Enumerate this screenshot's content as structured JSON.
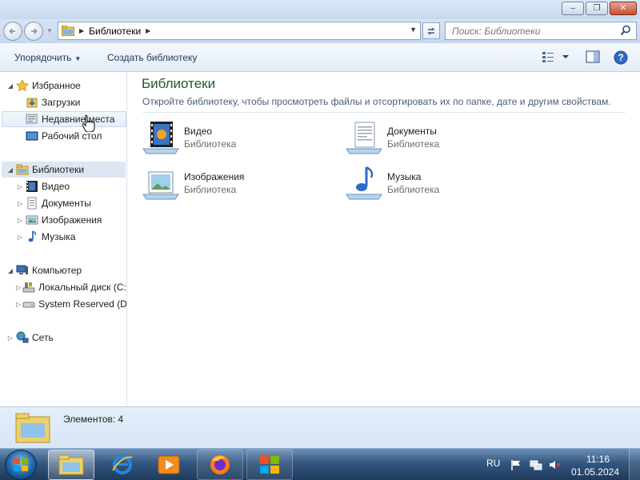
{
  "window": {
    "buttons": {
      "minimize": "‒",
      "maximize": "❐",
      "close": "✕"
    }
  },
  "address_bar": {
    "breadcrumb": [
      "Библиотеки"
    ],
    "search_placeholder": "Поиск: Библиотеки"
  },
  "toolbar": {
    "organize_label": "Упорядочить",
    "create_library_label": "Создать библиотеку"
  },
  "nav": {
    "favorites": {
      "label": "Избранное",
      "items": [
        {
          "label": "Загрузки",
          "icon": "downloads-icon"
        },
        {
          "label": "Недавние места",
          "icon": "recent-places-icon"
        },
        {
          "label": "Рабочий стол",
          "icon": "desktop-icon"
        }
      ]
    },
    "libraries": {
      "label": "Библиотеки",
      "items": [
        {
          "label": "Видео",
          "icon": "video-icon"
        },
        {
          "label": "Документы",
          "icon": "documents-icon"
        },
        {
          "label": "Изображения",
          "icon": "pictures-icon"
        },
        {
          "label": "Музыка",
          "icon": "music-icon"
        }
      ]
    },
    "computer": {
      "label": "Компьютер",
      "items": [
        {
          "label": "Локальный диск (C:)",
          "icon": "local-disk-icon"
        },
        {
          "label": "System Reserved (D:)",
          "icon": "drive-icon"
        }
      ]
    },
    "network": {
      "label": "Сеть"
    }
  },
  "content": {
    "title": "Библиотеки",
    "subtitle": "Откройте библиотеку, чтобы просмотреть файлы и отсортировать их по папке, дате и другим свойствам.",
    "libraries": [
      {
        "name": "Видео",
        "type": "Библиотека",
        "icon": "video-library-icon"
      },
      {
        "name": "Документы",
        "type": "Библиотека",
        "icon": "documents-library-icon"
      },
      {
        "name": "Изображения",
        "type": "Библиотека",
        "icon": "pictures-library-icon"
      },
      {
        "name": "Музыка",
        "type": "Библиотека",
        "icon": "music-library-icon"
      }
    ]
  },
  "details": {
    "count_text": "Элементов: 4"
  },
  "taskbar": {
    "apps": [
      "explorer",
      "internet-explorer",
      "media-player",
      "firefox",
      "windows-flag"
    ],
    "language": "RU",
    "time": "11:16",
    "date": "01.05.2024"
  },
  "colors": {
    "title_green": "#1e5c2a",
    "link_blue": "#1e395b",
    "taskbar_dark": "#1f3a5c"
  }
}
